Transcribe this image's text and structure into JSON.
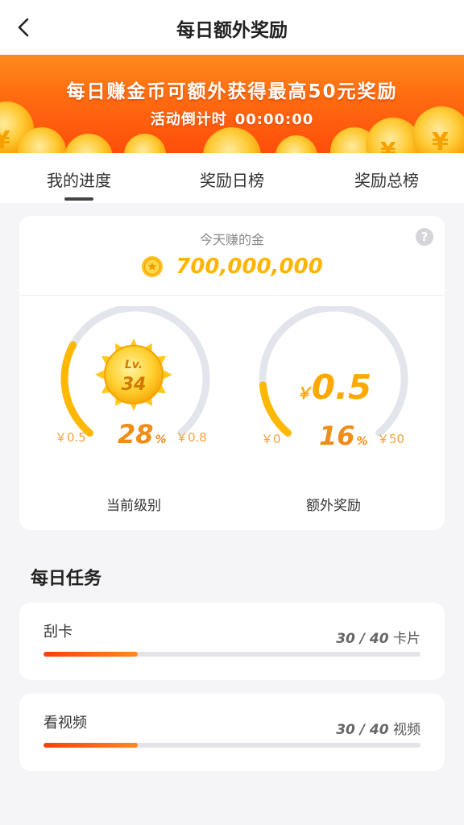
{
  "header": {
    "title": "每日额外奖励",
    "back_icon": "chevron-left-icon"
  },
  "banner": {
    "headline": "每日赚金币可额外获得最高50元奖励",
    "countdown_label": "活动倒计时",
    "countdown_value": "00:00:00"
  },
  "tabs": [
    {
      "label": "我的进度",
      "active": true
    },
    {
      "label": "奖励日榜",
      "active": false
    },
    {
      "label": "奖励总榜",
      "active": false
    }
  ],
  "summary": {
    "earned_label": "今天赚的金",
    "earned_value": "700,000,000",
    "help_icon": "question-icon",
    "coin_icon": "gold-coin-icon"
  },
  "level_gauge": {
    "badge_prefix": "Lv.",
    "level": "34",
    "percent": "28",
    "percent_unit": "%",
    "min": "￥0.5",
    "max": "￥0.8",
    "caption": "当前级别",
    "progress": 0.28
  },
  "bonus_gauge": {
    "currency": "￥",
    "amount": "0.5",
    "percent": "16",
    "percent_unit": "%",
    "min": "￥0",
    "max": "￥50",
    "caption": "额外奖励",
    "progress": 0.16
  },
  "tasks_section": {
    "title": "每日任务",
    "tasks": [
      {
        "name": "刮卡",
        "current": "30",
        "separator": " / ",
        "total": "40",
        "unit": "卡片",
        "progress": 0.25
      },
      {
        "name": "看视频",
        "current": "30",
        "separator": " / ",
        "total": "40",
        "unit": "视频",
        "progress": 0.25
      }
    ]
  },
  "colors": {
    "accent_orange": "#ff6a10",
    "gold": "#ffb400",
    "gauge_track": "#e2e5ec",
    "gauge_fill": "#ffb800"
  }
}
